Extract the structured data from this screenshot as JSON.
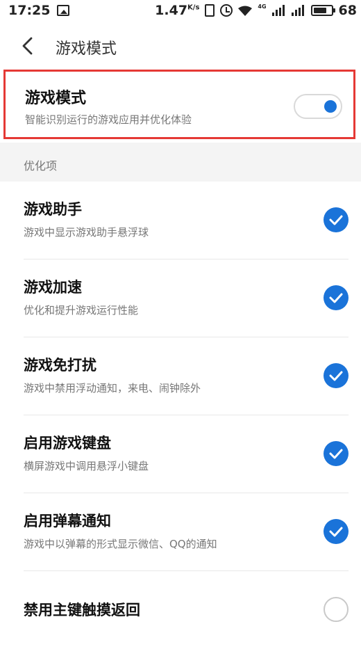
{
  "status_bar": {
    "time": "17:25",
    "speed": "1.47",
    "speed_unit": "K/s",
    "network_label": "4G",
    "battery": "68"
  },
  "header": {
    "back_icon": "chevron-left-icon",
    "title": "游戏模式"
  },
  "game_mode": {
    "title": "游戏模式",
    "subtitle": "智能识别运行的游戏应用并优化体验",
    "enabled": true
  },
  "section": {
    "label": "优化项"
  },
  "items": [
    {
      "title": "游戏助手",
      "subtitle": "游戏中显示游戏助手悬浮球",
      "checked": true
    },
    {
      "title": "游戏加速",
      "subtitle": "优化和提升游戏运行性能",
      "checked": true
    },
    {
      "title": "游戏免打扰",
      "subtitle": "游戏中禁用浮动通知，来电、闹钟除外",
      "checked": true
    },
    {
      "title": "启用游戏键盘",
      "subtitle": "横屏游戏中调用悬浮小键盘",
      "checked": true
    },
    {
      "title": "启用弹幕通知",
      "subtitle": "游戏中以弹幕的形式显示微信、QQ的通知",
      "checked": true
    },
    {
      "title": "禁用主键触摸返回",
      "subtitle": "",
      "checked": false
    }
  ],
  "colors": {
    "accent": "#1a73d9",
    "highlight_border": "#e53935",
    "section_bg": "#f4f4f4"
  }
}
